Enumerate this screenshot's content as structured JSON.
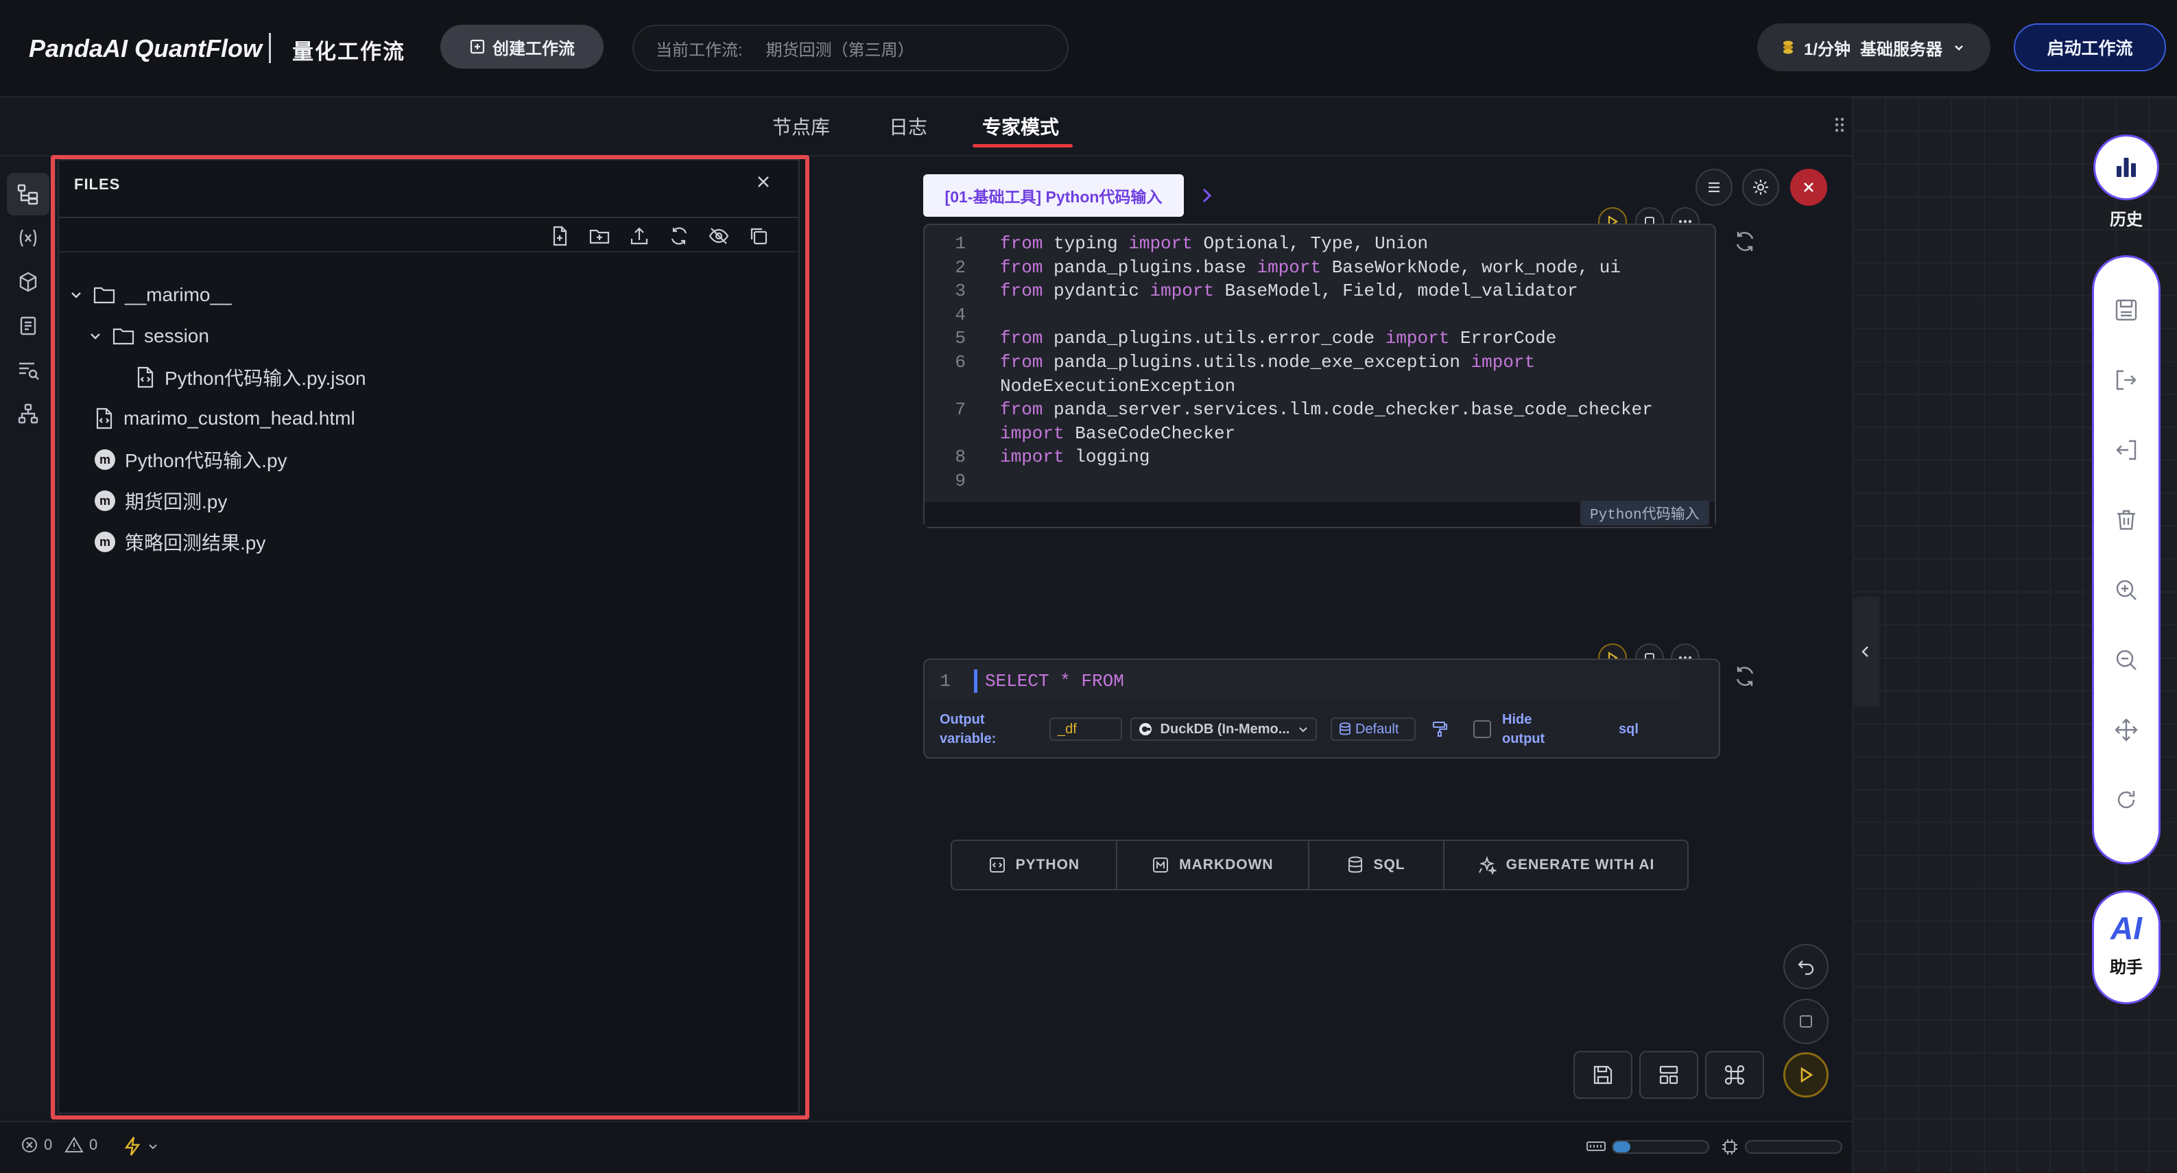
{
  "header": {
    "brand": "PandaAI QuantFlow",
    "product": "量化工作流",
    "create_button": "创建工作流",
    "current_label": "当前工作流:",
    "current_value": "期货回测（第三周）",
    "billing": "1/分钟",
    "server": "基础服务器",
    "start_button": "启动工作流"
  },
  "tabs": [
    "节点库",
    "日志",
    "专家模式"
  ],
  "active_tab": "专家模式",
  "files": {
    "title": "FILES",
    "tree": [
      {
        "name": "__marimo__",
        "type": "folder",
        "depth": 0,
        "expanded": true
      },
      {
        "name": "session",
        "type": "folder",
        "depth": 1,
        "expanded": true
      },
      {
        "name": "Python代码输入.py.json",
        "type": "file",
        "depth": 2
      },
      {
        "name": "marimo_custom_head.html",
        "type": "file",
        "depth": 0
      },
      {
        "name": "Python代码输入.py",
        "type": "marimo",
        "depth": 0
      },
      {
        "name": "期货回测.py",
        "type": "marimo",
        "depth": 0
      },
      {
        "name": "策略回测结果.py",
        "type": "marimo",
        "depth": 0
      }
    ]
  },
  "cell1": {
    "label": "[01-基础工具] Python代码输入",
    "tag": "Python代码输入",
    "lines": [
      {
        "n": "1",
        "text": [
          [
            "kw",
            "from"
          ],
          [
            "",
            "typing"
          ],
          [
            "kw",
            "import"
          ],
          [
            "",
            "Optional, Type, Union"
          ]
        ]
      },
      {
        "n": "2",
        "text": [
          [
            "kw",
            "from"
          ],
          [
            "",
            "panda_plugins.base"
          ],
          [
            "kw",
            "import"
          ],
          [
            "",
            "BaseWorkNode, work_node, ui"
          ]
        ]
      },
      {
        "n": "3",
        "text": [
          [
            "kw",
            "from"
          ],
          [
            "",
            "pydantic"
          ],
          [
            "kw",
            "import"
          ],
          [
            "",
            "BaseModel, Field, model_validator"
          ]
        ]
      },
      {
        "n": "4",
        "text": []
      },
      {
        "n": "5",
        "text": [
          [
            "kw",
            "from"
          ],
          [
            "",
            "panda_plugins.utils.error_code"
          ],
          [
            "kw",
            "import"
          ],
          [
            "",
            "ErrorCode"
          ]
        ]
      },
      {
        "n": "6",
        "text": [
          [
            "kw",
            "from"
          ],
          [
            "",
            "panda_plugins.utils.node_exe_exception"
          ],
          [
            "kw",
            "import"
          ]
        ]
      },
      {
        "n": "",
        "text": [
          [
            "",
            "NodeExecutionException"
          ]
        ]
      },
      {
        "n": "7",
        "text": [
          [
            "kw",
            "from"
          ],
          [
            "",
            "panda_server.services.llm.code_checker.base_code_checker"
          ]
        ]
      },
      {
        "n": "",
        "text": [
          [
            "kw",
            "import"
          ],
          [
            "",
            "BaseCodeChecker"
          ]
        ]
      },
      {
        "n": "8",
        "text": [
          [
            "kw",
            "import"
          ],
          [
            "",
            "logging"
          ]
        ]
      },
      {
        "n": "9",
        "text": []
      }
    ]
  },
  "cell2": {
    "line_number": "1",
    "code": "SELECT * FROM",
    "output_label_1": "Output",
    "output_label_2": "variable:",
    "output_var": "_df",
    "engine": "DuckDB (In-Memo...",
    "schema": "Default",
    "hide_1": "Hide",
    "hide_2": "output",
    "lang": "sql"
  },
  "add_cell": [
    "PYTHON",
    "MARKDOWN",
    "SQL",
    "GENERATE WITH AI"
  ],
  "sidebar_right": {
    "history": "历史",
    "ai_text": "AI",
    "assistant": "助手"
  },
  "status": {
    "errors": "0",
    "warnings": "0"
  },
  "colors": {
    "accent_red": "#e5494d",
    "accent_purple": "#6a4ef0",
    "start_blue": "#0c1b52",
    "run_gold": "#e0b52e"
  }
}
